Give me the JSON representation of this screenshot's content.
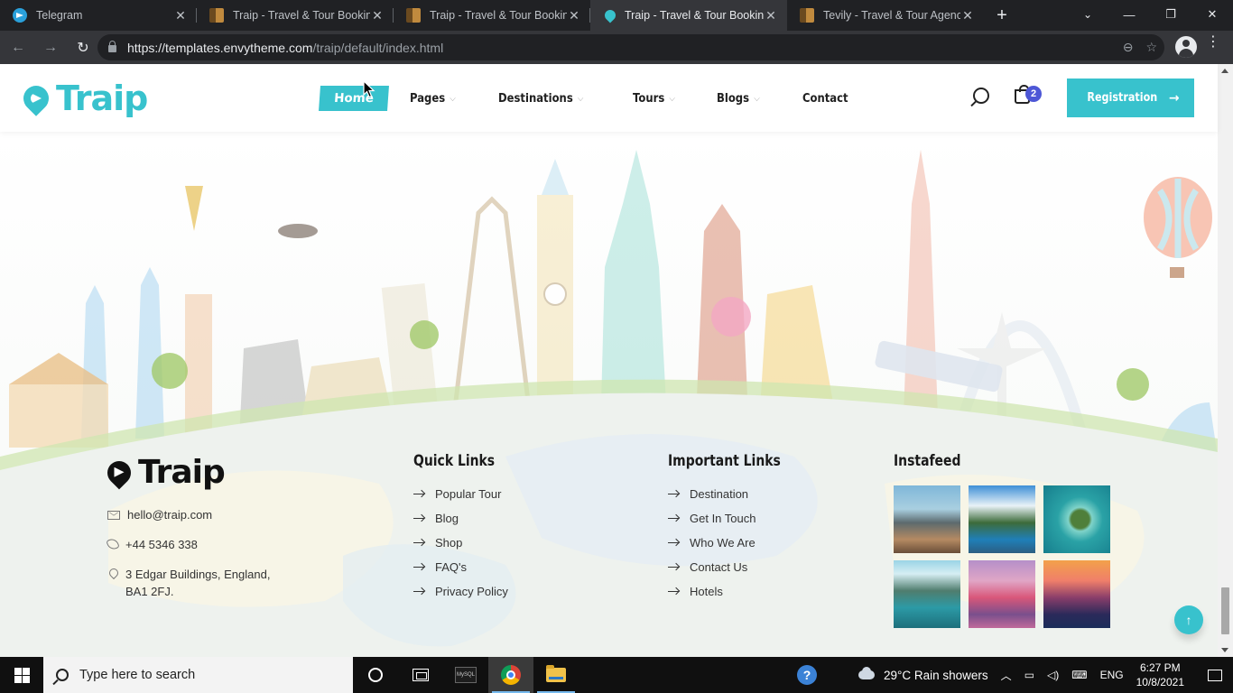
{
  "browser": {
    "tabs": [
      {
        "title": "Telegram",
        "favicon": "telegram-icon",
        "active": false
      },
      {
        "title": "Traip - Travel & Tour Booking",
        "favicon": "book-icon",
        "active": false
      },
      {
        "title": "Traip - Travel & Tour Booking",
        "favicon": "book-icon",
        "active": false
      },
      {
        "title": "Traip - Travel & Tour Booking",
        "favicon": "traip-icon",
        "active": true
      },
      {
        "title": "Tevily - Travel & Tour Agency",
        "favicon": "book-icon",
        "active": false
      }
    ],
    "url_domain": "https://templates.envytheme.com",
    "url_path": "/traip/default/index.html"
  },
  "site": {
    "logo_text": "Traip",
    "nav": [
      {
        "label": "Home",
        "has_caret": false,
        "active": true
      },
      {
        "label": "Pages",
        "has_caret": true,
        "active": false
      },
      {
        "label": "Destinations",
        "has_caret": true,
        "active": false
      },
      {
        "label": "Tours",
        "has_caret": true,
        "active": false
      },
      {
        "label": "Blogs",
        "has_caret": true,
        "active": false
      },
      {
        "label": "Contact",
        "has_caret": false,
        "active": false
      }
    ],
    "cart_count": "2",
    "registration_label": "Registration",
    "accent_color": "#38c2cd"
  },
  "footer": {
    "logo_text": "Traip",
    "email": "hello@traip.com",
    "phone": "+44 5346 338",
    "address": "3 Edgar Buildings, England, BA1 2FJ.",
    "quick_links": {
      "title": "Quick Links",
      "items": [
        "Popular Tour",
        "Blog",
        "Shop",
        "FAQ's",
        "Privacy Policy"
      ]
    },
    "important_links": {
      "title": "Important Links",
      "items": [
        "Destination",
        "Get In Touch",
        "Who We Are",
        "Contact Us",
        "Hotels"
      ]
    },
    "instafeed": {
      "title": "Instafeed",
      "images": [
        "rocky-beach",
        "mountain-lake",
        "tropical-island",
        "fjord-mountains",
        "colorful-harbor",
        "sunset-cliff"
      ]
    }
  },
  "taskbar": {
    "search_placeholder": "Type here to search",
    "weather": "29°C  Rain showers",
    "language": "ENG",
    "time": "6:27 PM",
    "date": "10/8/2021",
    "mysql_label": "MySQL"
  }
}
